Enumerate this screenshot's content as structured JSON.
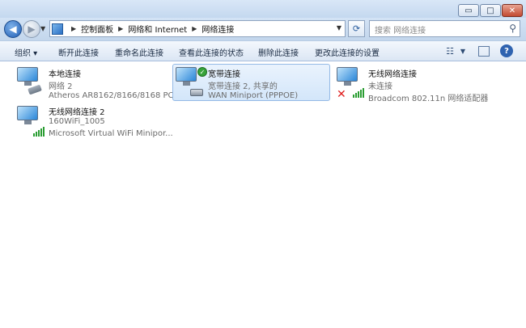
{
  "window": {
    "controls": {
      "minimize": "▭",
      "maximize": "□",
      "close": "✕"
    }
  },
  "address": {
    "crumbs": [
      "控制面板",
      "网络和 Internet",
      "网络连接"
    ],
    "search_placeholder": "搜索 网络连接"
  },
  "toolbar": {
    "organize": "组织 ▾",
    "disconnect": "断开此连接",
    "rename": "重命名此连接",
    "view_status": "查看此连接的状态",
    "delete": "删除此连接",
    "change_settings": "更改此连接的设置"
  },
  "connections": [
    {
      "name": "本地连接",
      "status": "网络 2",
      "device": "Atheros AR8162/8166/8168 PC...",
      "icon": "wired-network-icon"
    },
    {
      "name": "宽带连接",
      "status": "宽带连接 2, 共享的",
      "device": "WAN Miniport (PPPOE)",
      "icon": "broadband-connection-icon",
      "selected": true
    },
    {
      "name": "无线网络连接",
      "status": "未连接",
      "device": "Broadcom 802.11n 网络适配器",
      "icon": "wireless-network-icon"
    },
    {
      "name": "无线网络连接 2",
      "status": "160WiFi_1005",
      "device": "Microsoft Virtual WiFi Minipor...",
      "icon": "wireless-network-icon"
    }
  ],
  "colors": {
    "selection": "#d3e6fa",
    "accent": "#2a6fc4",
    "signal": "#2a9d32",
    "error": "#e02020"
  }
}
